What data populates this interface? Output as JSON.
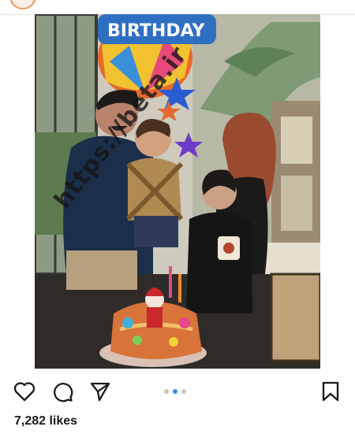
{
  "post": {
    "likes_text": "7,282 likes",
    "watermark": "https://beta.ir",
    "balloon_text": "BIRTHDAY",
    "carousel": {
      "count": 3,
      "active_index": 1
    }
  },
  "icons": {
    "like": "heart-icon",
    "comment": "comment-icon",
    "share": "send-icon",
    "save": "bookmark-icon"
  },
  "colors": {
    "accent": "#2f8fe8",
    "dot_inactive": "#c7c7c7",
    "avatar_ring": "#e89a5a"
  }
}
